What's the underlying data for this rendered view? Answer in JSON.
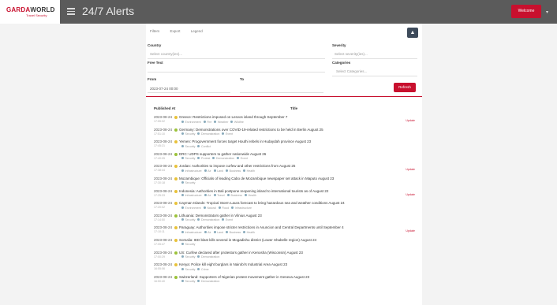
{
  "brand": {
    "name_red": "GARDA",
    "name_dark": "WORLD",
    "subtitle": "Travel Security"
  },
  "header": {
    "title": "24/7 Alerts",
    "user_label": "Welcome",
    "caret": "▾"
  },
  "tabs": [
    "Filters",
    "Export",
    "Legend"
  ],
  "filters": {
    "country_label": "Country",
    "country_placeholder": "Select country(ies)...",
    "severity_label": "Severity",
    "severity_placeholder": "Select severity(ies)...",
    "free_text_label": "Free Text",
    "free_text_placeholder": "",
    "categories_label": "Categories",
    "categories_placeholder": "Select Categories...",
    "from_label": "From",
    "from_value": "2023-07-24 00:00",
    "to_label": "To",
    "to_value": "",
    "refresh_label": "Refresh"
  },
  "table": {
    "published_header": "Published At",
    "title_header": "Title"
  },
  "rows": [
    {
      "date": "2023-08-24",
      "time": "17:55:02",
      "severity_color": "#e8c23a",
      "title": "Greece: Restrictions imposed on Lesvos island through September 7",
      "tags": [
        "Environment",
        "Fire",
        "Weather",
        "Wildfire"
      ],
      "flag": "Update"
    },
    {
      "date": "2023-08-24",
      "time": "17:51:10",
      "severity_color": "#9cc23a",
      "title": "Germany: Demonstrations over COVID-19-related restrictions to be held in Berlin August 25",
      "tags": [
        "Security",
        "Demonstration",
        "Event"
      ],
      "flag": ""
    },
    {
      "date": "2023-08-24",
      "time": "17:45:21",
      "severity_color": "#e8c23a",
      "title": "Yemen: Progovernment forces target Houthi rebels in Hudaydah province August 23",
      "tags": [
        "Security",
        "Conflict"
      ],
      "flag": ""
    },
    {
      "date": "2023-08-24",
      "time": "17:40:05",
      "severity_color": "#9cc23a",
      "title": "DRC: UDPS supporters to gather nationwide August 26",
      "tags": [
        "Security",
        "Protest",
        "Demonstration",
        "Event"
      ],
      "flag": ""
    },
    {
      "date": "2023-08-24",
      "time": "17:38:44",
      "severity_color": "#e8c23a",
      "title": "Jordan: Authorities to impose curfew and other restrictions from August 25",
      "tags": [
        "Infrastructure",
        "Air",
        "Land",
        "Business",
        "Health"
      ],
      "flag": "Update"
    },
    {
      "date": "2023-08-24",
      "time": "17:30:18",
      "severity_color": "#e8c23a",
      "title": "Mozambique: Officials of leading Cabo de Mozambique newspaper set attack in Maputo August 23",
      "tags": [
        "Security"
      ],
      "flag": ""
    },
    {
      "date": "2023-08-24",
      "time": "17:25:33",
      "severity_color": "#e8c23a",
      "title": "Indonesia: Authorities in Bali postpone reopening island to international tourists as of August 22",
      "tags": [
        "Infrastructure",
        "Air",
        "Travel",
        "Business",
        "Health"
      ],
      "flag": "Update"
    },
    {
      "date": "2023-08-24",
      "time": "17:20:02",
      "severity_color": "#e8c23a",
      "title": "Cayman Islands: Tropical Storm Laura forecast to bring hazardous sea and weather conditions August 24",
      "tags": [
        "Environment",
        "Natural",
        "Flood",
        "Infrastructure"
      ],
      "flag": ""
    },
    {
      "date": "2023-08-24",
      "time": "17:14:50",
      "severity_color": "#9cc23a",
      "title": "Lithuania: Demonstrators gather in Vilnius August 23",
      "tags": [
        "Security",
        "Demonstration",
        "Event"
      ],
      "flag": ""
    },
    {
      "date": "2023-08-24",
      "time": "17:10:11",
      "severity_color": "#e8c23a",
      "title": "Paraguay: Authorities impose stricter restrictions in Asuncion and Central Departments until September 4",
      "tags": [
        "Infrastructure",
        "Air",
        "Land",
        "Business",
        "Health"
      ],
      "flag": "Update"
    },
    {
      "date": "2023-08-24",
      "time": "17:05:47",
      "severity_color": "#e8c23a",
      "title": "Somalia: IED blast kills several in Mogadishu district (Lower Shabelle region) August 24",
      "tags": [
        "Security"
      ],
      "flag": ""
    },
    {
      "date": "2023-08-24",
      "time": "17:00:29",
      "severity_color": "#9cc23a",
      "title": "US: Curfew declared after protestors gather in Kenosha (Wisconsin) August 23",
      "tags": [
        "Security",
        "Demonstration"
      ],
      "flag": ""
    },
    {
      "date": "2023-08-24",
      "time": "16:55:06",
      "severity_color": "#e8c23a",
      "title": "Kenya: Police kill eight burglars in Nairobi's Industrial Area August 23",
      "tags": [
        "Security",
        "Crime"
      ],
      "flag": ""
    },
    {
      "date": "2023-08-24",
      "time": "16:50:40",
      "severity_color": "#9cc23a",
      "title": "Switzerland: Supporters of Nigerian protest movement gather in Geneva August 23",
      "tags": [
        "Security",
        "Demonstration"
      ],
      "flag": ""
    }
  ]
}
